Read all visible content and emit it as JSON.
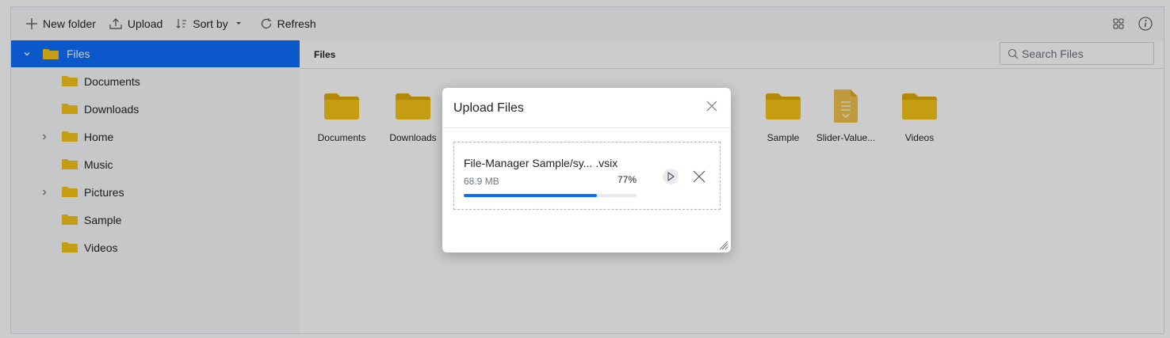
{
  "toolbar": {
    "new_folder": "New folder",
    "upload": "Upload",
    "sort_by": "Sort by",
    "refresh": "Refresh",
    "icons": [
      "plus-icon",
      "upload-icon",
      "sort-icon",
      "caret-down-icon",
      "refresh-icon",
      "grid-view-icon",
      "info-icon"
    ]
  },
  "nav": {
    "root": "Files",
    "items": [
      {
        "label": "Documents",
        "expandable": false
      },
      {
        "label": "Downloads",
        "expandable": false
      },
      {
        "label": "Home",
        "expandable": true
      },
      {
        "label": "Music",
        "expandable": false
      },
      {
        "label": "Pictures",
        "expandable": true
      },
      {
        "label": "Sample",
        "expandable": false
      },
      {
        "label": "Videos",
        "expandable": false
      }
    ]
  },
  "content": {
    "breadcrumb": "Files",
    "search_placeholder": "Search Files",
    "tiles": [
      {
        "name": "Documents",
        "type": "folder"
      },
      {
        "name": "Downloads",
        "type": "folder"
      },
      {
        "name": "Sample",
        "type": "folder"
      },
      {
        "name": "Slider-Value...",
        "type": "file"
      },
      {
        "name": "Videos",
        "type": "folder"
      }
    ]
  },
  "dialog": {
    "title": "Upload Files",
    "file_name": "File-Manager Sample/sy... .vsix",
    "file_size": "68.9 MB",
    "percent_label": "77%",
    "progress": 0.77
  },
  "colors": {
    "accent": "#0d6efd",
    "folder": "#f5c518",
    "folder_dark": "#e0ab0a",
    "file": "#f2c14e"
  }
}
